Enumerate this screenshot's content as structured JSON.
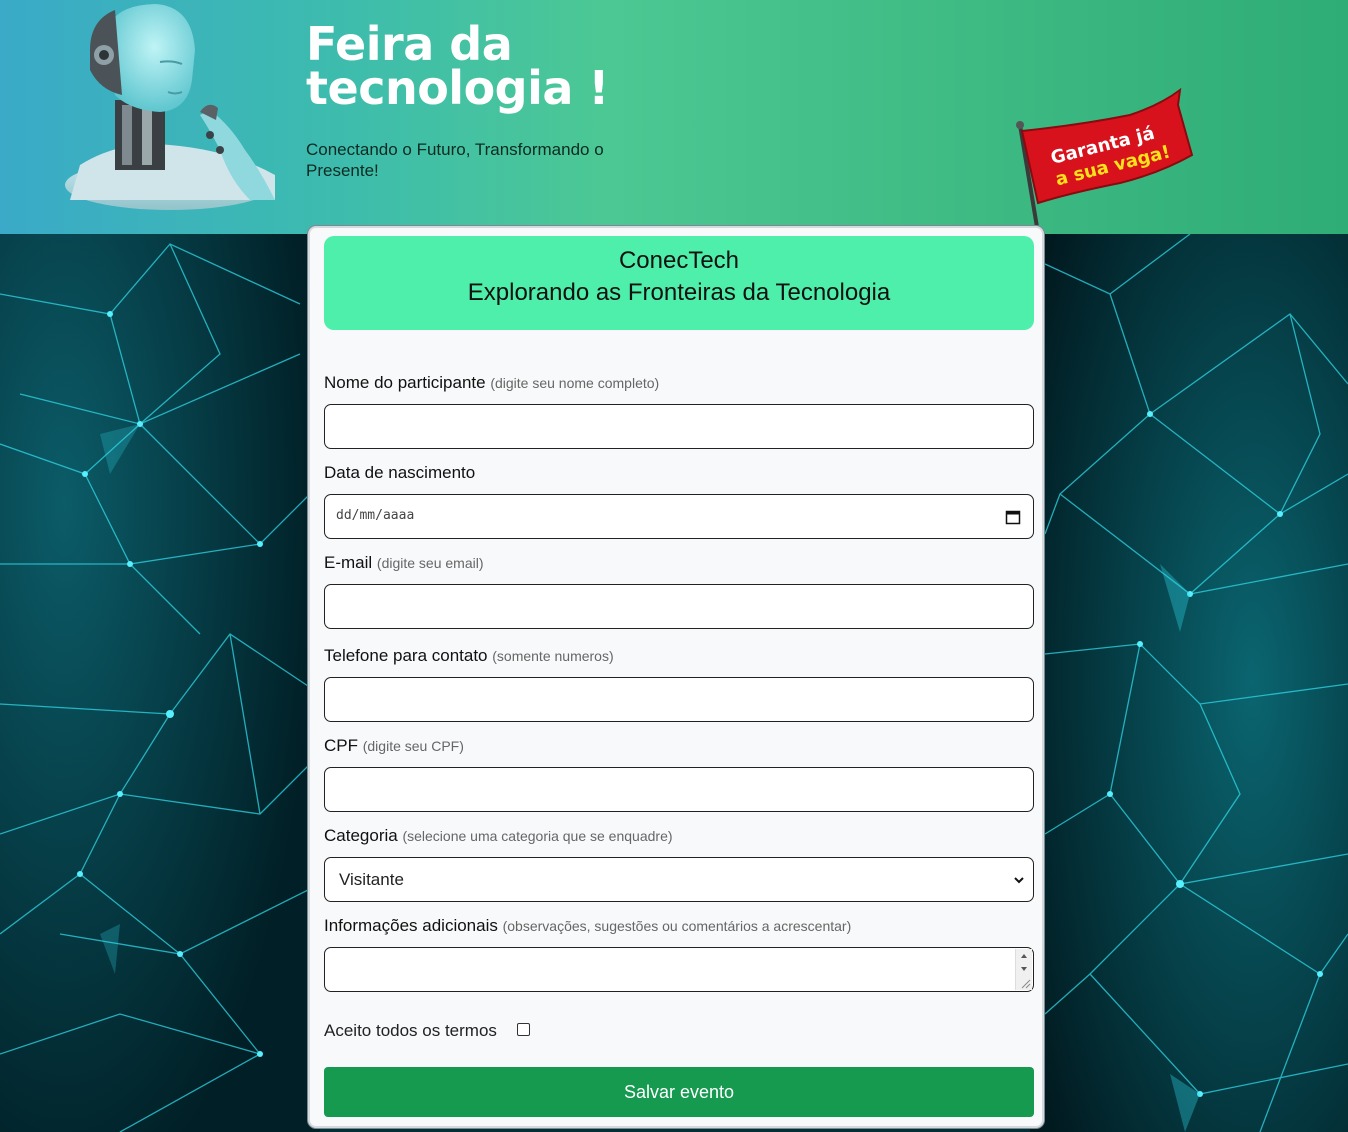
{
  "header": {
    "title_line1": "Feira da",
    "title_line2": "tecnologia !",
    "subtitle": "Conectando o Futuro, Transformando o Presente!",
    "flag_line1": "Garanta já",
    "flag_line2": "a sua vaga!"
  },
  "card": {
    "title": "ConecTech",
    "subtitle": "Explorando as Fronteiras da Tecnologia"
  },
  "form": {
    "name": {
      "label": "Nome do participante",
      "hint": "(digite seu nome completo)",
      "value": ""
    },
    "birth": {
      "label": "Data de nascimento",
      "placeholder": "dd/mm/aaaa"
    },
    "email": {
      "label": "E-mail",
      "hint": "(digite seu email)",
      "value": ""
    },
    "phone": {
      "label": "Telefone para contato",
      "hint": "(somente numeros)",
      "value": ""
    },
    "cpf": {
      "label": "CPF",
      "hint": "(digite seu CPF)",
      "value": ""
    },
    "category": {
      "label": "Categoria",
      "hint": "(selecione uma categoria que se enquadre)",
      "selected": "Visitante"
    },
    "info": {
      "label": "Informações adicionais",
      "hint": "(observações, sugestões ou comentários a acrescentar)",
      "value": ""
    },
    "terms_label": "Aceito todos os termos",
    "terms_checked": false,
    "submit_label": "Salvar evento"
  },
  "colors": {
    "card_header": "#4eefaa",
    "button": "#159a4f",
    "flag": "#d8121c",
    "background": "#022e36",
    "network_lines": "#2fd8e8"
  }
}
